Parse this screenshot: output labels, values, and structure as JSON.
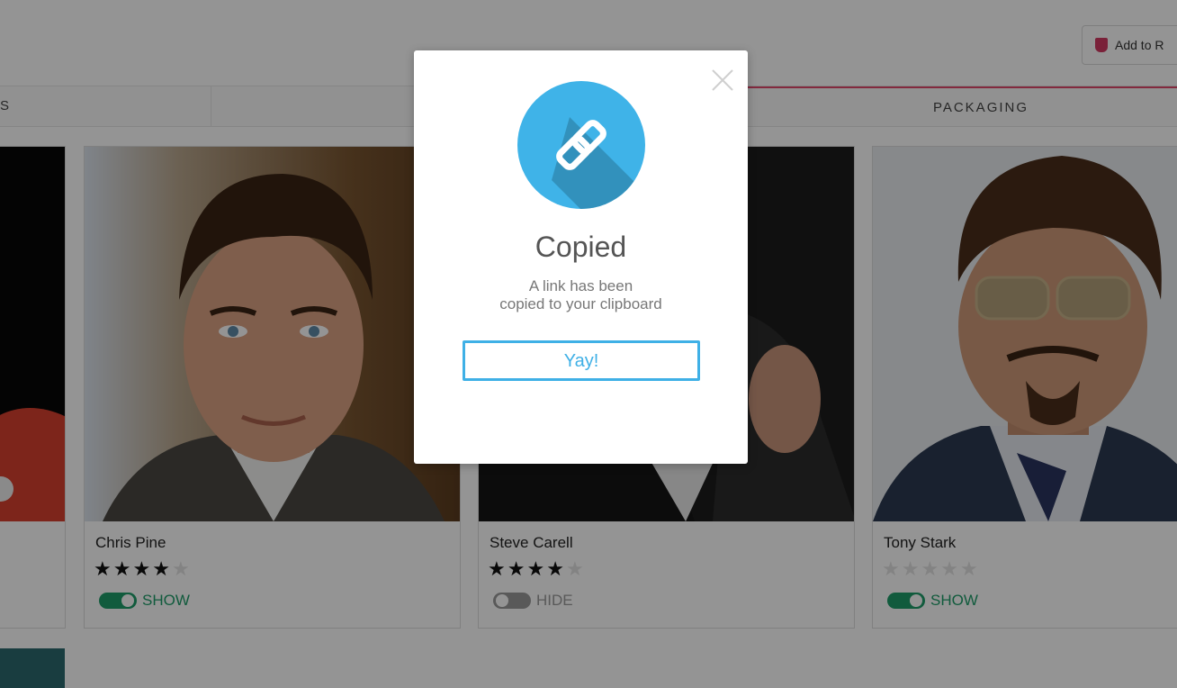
{
  "header": {
    "add_button_label": "Add to R"
  },
  "tabs": [
    {
      "label": "S"
    },
    {
      "label": ""
    },
    {
      "label": "PACKAGING"
    }
  ],
  "cards": [
    {
      "name": "Chris Pine",
      "rating": 4,
      "max_rating": 5,
      "toggle_state": "on",
      "toggle_label": "SHOW"
    },
    {
      "name": "Steve Carell",
      "rating": 4,
      "max_rating": 5,
      "toggle_state": "off",
      "toggle_label": "HIDE"
    },
    {
      "name": "Tony Stark",
      "rating": 0,
      "max_rating": 5,
      "toggle_state": "on",
      "toggle_label": "SHOW"
    }
  ],
  "modal": {
    "title": "Copied",
    "message_line1": "A link has been",
    "message_line2": "copied to your clipboard",
    "button_label": "Yay!"
  },
  "colors": {
    "accent_blue": "#3fb0e6",
    "toggle_green": "#1e9d69",
    "tab_active": "#e2486c",
    "overlay": "rgba(0,0,0,0.42)"
  },
  "icons": {
    "close": "close-icon",
    "link": "link-icon",
    "badge": "bookmark-badge-icon"
  }
}
